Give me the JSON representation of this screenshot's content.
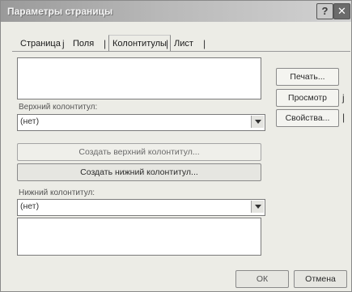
{
  "window": {
    "title": "Параметры страницы"
  },
  "titlebar_buttons": {
    "help": "?",
    "close": "✕"
  },
  "tabs": [
    {
      "label": "Страница"
    },
    {
      "label": "Поля"
    },
    {
      "label": "Колонтитулы"
    },
    {
      "label": "Лист"
    }
  ],
  "tab_separators": [
    "j",
    "|",
    "|",
    "|"
  ],
  "side_buttons": {
    "print": "Печать...",
    "preview": "Просмотр",
    "preview_mark": "j",
    "properties": "Свойства...",
    "properties_mark": "|"
  },
  "header": {
    "label": "Верхний колонтитул:",
    "value": "(нет)"
  },
  "create_header_button": "Создать верхний колонтитул...",
  "create_footer_button": "Создать нижний колонтитул...",
  "footer": {
    "label": "Нижний колонтитул:",
    "value": "(нет)"
  },
  "footer_buttons": {
    "ok": "ОК",
    "cancel": "Отмена"
  }
}
